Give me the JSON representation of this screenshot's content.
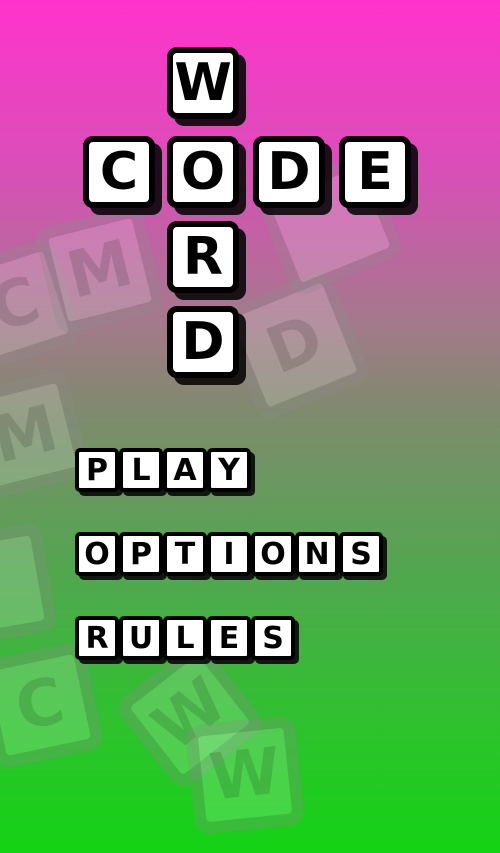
{
  "title": {
    "across_word": [
      "C",
      "O",
      "D",
      "E"
    ],
    "down_word": [
      "W",
      "O",
      "R",
      "D"
    ]
  },
  "background_tiles": [
    "C",
    "M",
    "D",
    "M",
    "C",
    "W",
    "W"
  ],
  "menu": {
    "play": [
      "P",
      "L",
      "A",
      "Y"
    ],
    "options": [
      "O",
      "P",
      "T",
      "I",
      "O",
      "N",
      "S"
    ],
    "rules": [
      "R",
      "U",
      "L",
      "E",
      "S"
    ]
  },
  "colors": {
    "gradient_top": "#ff33cc",
    "gradient_bottom": "#14d314",
    "tile_face": "#ffffff",
    "tile_border": "#000000"
  }
}
